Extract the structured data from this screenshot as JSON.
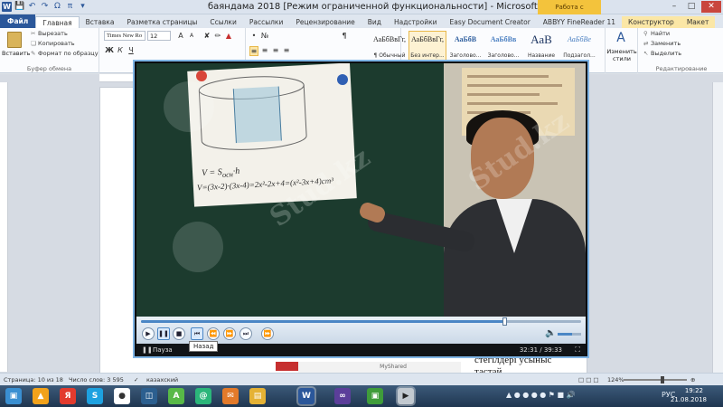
{
  "window": {
    "title": "баяндама 2018 [Режим ограниченной функциональности]  -  Microsoft Word",
    "context_tab_group": "Работа с таблицами",
    "app_logo_letter": "W"
  },
  "ribbon_tabs": [
    {
      "label": "Файл"
    },
    {
      "label": "Главная"
    },
    {
      "label": "Вставка"
    },
    {
      "label": "Разметка страницы"
    },
    {
      "label": "Ссылки"
    },
    {
      "label": "Рассылки"
    },
    {
      "label": "Рецензирование"
    },
    {
      "label": "Вид"
    },
    {
      "label": "Надстройки"
    },
    {
      "label": "Easy Document Creator"
    },
    {
      "label": "ABBYY FineReader 11"
    },
    {
      "label": "Конструктор"
    },
    {
      "label": "Макет"
    }
  ],
  "clipboard": {
    "paste": "Вставить",
    "cut": "Вырезать",
    "copy": "Копировать",
    "format_painter": "Формат по образцу",
    "group_label": "Буфер обмена"
  },
  "font": {
    "name": "Times New Ro",
    "size": "12",
    "bold": "Ж",
    "italic": "К",
    "underline": "Ч",
    "grow": "A",
    "shrink": "A"
  },
  "styles": [
    {
      "sample": "АаБбВвГг,",
      "name": "¶ Обычный"
    },
    {
      "sample": "АаБбВвГг,",
      "name": "Без интер..."
    },
    {
      "sample": "АаБбВ",
      "name": "Заголово..."
    },
    {
      "sample": "АаБбВв",
      "name": "Заголово..."
    },
    {
      "sample": "АаВ",
      "name": "Название"
    },
    {
      "sample": "АаБбВе",
      "name": "Подзагол..."
    }
  ],
  "change_styles": {
    "line1": "Изменить",
    "line2": "стили"
  },
  "editing": {
    "find": "Найти",
    "replace": "Заменить",
    "select": "Выделить",
    "group_label": "Редактирование"
  },
  "document": {
    "bottom_text": "стёгілдері усыныс тастай",
    "myshared": "MyShared"
  },
  "player": {
    "seek_progress": 0.826,
    "volume_level": 0.6,
    "state": "Пауза",
    "time": "32:31 / 39:33",
    "tooltip": "Назад"
  },
  "video": {
    "formula1": "V = S",
    "formula1_sub": "осн",
    "formula1_tail": "·h",
    "formula2": "V=(3x-2)·(3x-4)=2x²-2x+4=(x²-3x+4)cm³",
    "watermark": "Stud.kz"
  },
  "statusbar": {
    "page": "Страница: 10 из 18",
    "words": "Число слов: 3 595",
    "language": "казахский",
    "zoom": "124%",
    "zoom_level": 0.62
  },
  "taskbar": {
    "lang": "РУС",
    "time": "19:22",
    "date": "21.08.2018"
  }
}
